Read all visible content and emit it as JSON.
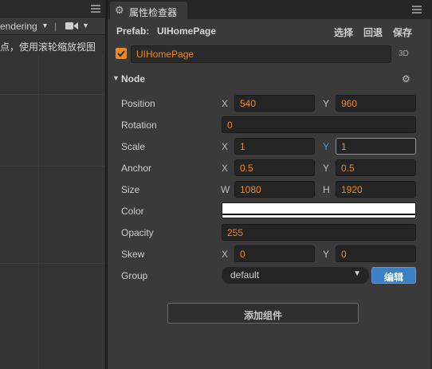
{
  "scene": {
    "toolbar_render_label": "endering",
    "toolbar_separator": "|",
    "hint": "点，使用滚轮缩放视图"
  },
  "inspector": {
    "tab_title": "属性检查器",
    "prefab": {
      "label": "Prefab:",
      "name": "UIHomePage",
      "select": "选择",
      "revert": "回退",
      "save": "保存"
    },
    "node_name": "UIHomePage",
    "mode_3d": "3D",
    "section_title": "Node",
    "properties": {
      "position": {
        "label": "Position",
        "x_axis": "X",
        "x": "540",
        "y_axis": "Y",
        "y": "960"
      },
      "rotation": {
        "label": "Rotation",
        "value": "0"
      },
      "scale": {
        "label": "Scale",
        "x_axis": "X",
        "x": "1",
        "y_axis": "Y",
        "y": "1"
      },
      "anchor": {
        "label": "Anchor",
        "x_axis": "X",
        "x": "0.5",
        "y_axis": "Y",
        "y": "0.5"
      },
      "size": {
        "label": "Size",
        "w_axis": "W",
        "w": "1080",
        "h_axis": "H",
        "h": "1920"
      },
      "color": {
        "label": "Color",
        "value": "#ffffff"
      },
      "opacity": {
        "label": "Opacity",
        "value": "255"
      },
      "skew": {
        "label": "Skew",
        "x_axis": "X",
        "x": "0",
        "y_axis": "Y",
        "y": "0"
      },
      "group": {
        "label": "Group",
        "value": "default",
        "edit": "编辑"
      }
    },
    "add_component": "添加组件"
  },
  "colors": {
    "accent_orange": "#f0861a",
    "accent_blue": "#3d7fc4"
  },
  "icons": [
    "menu-icon",
    "chevron-down-icon",
    "camera-icon",
    "gear-icon",
    "checkbox-icon",
    "caret-down-icon"
  ]
}
